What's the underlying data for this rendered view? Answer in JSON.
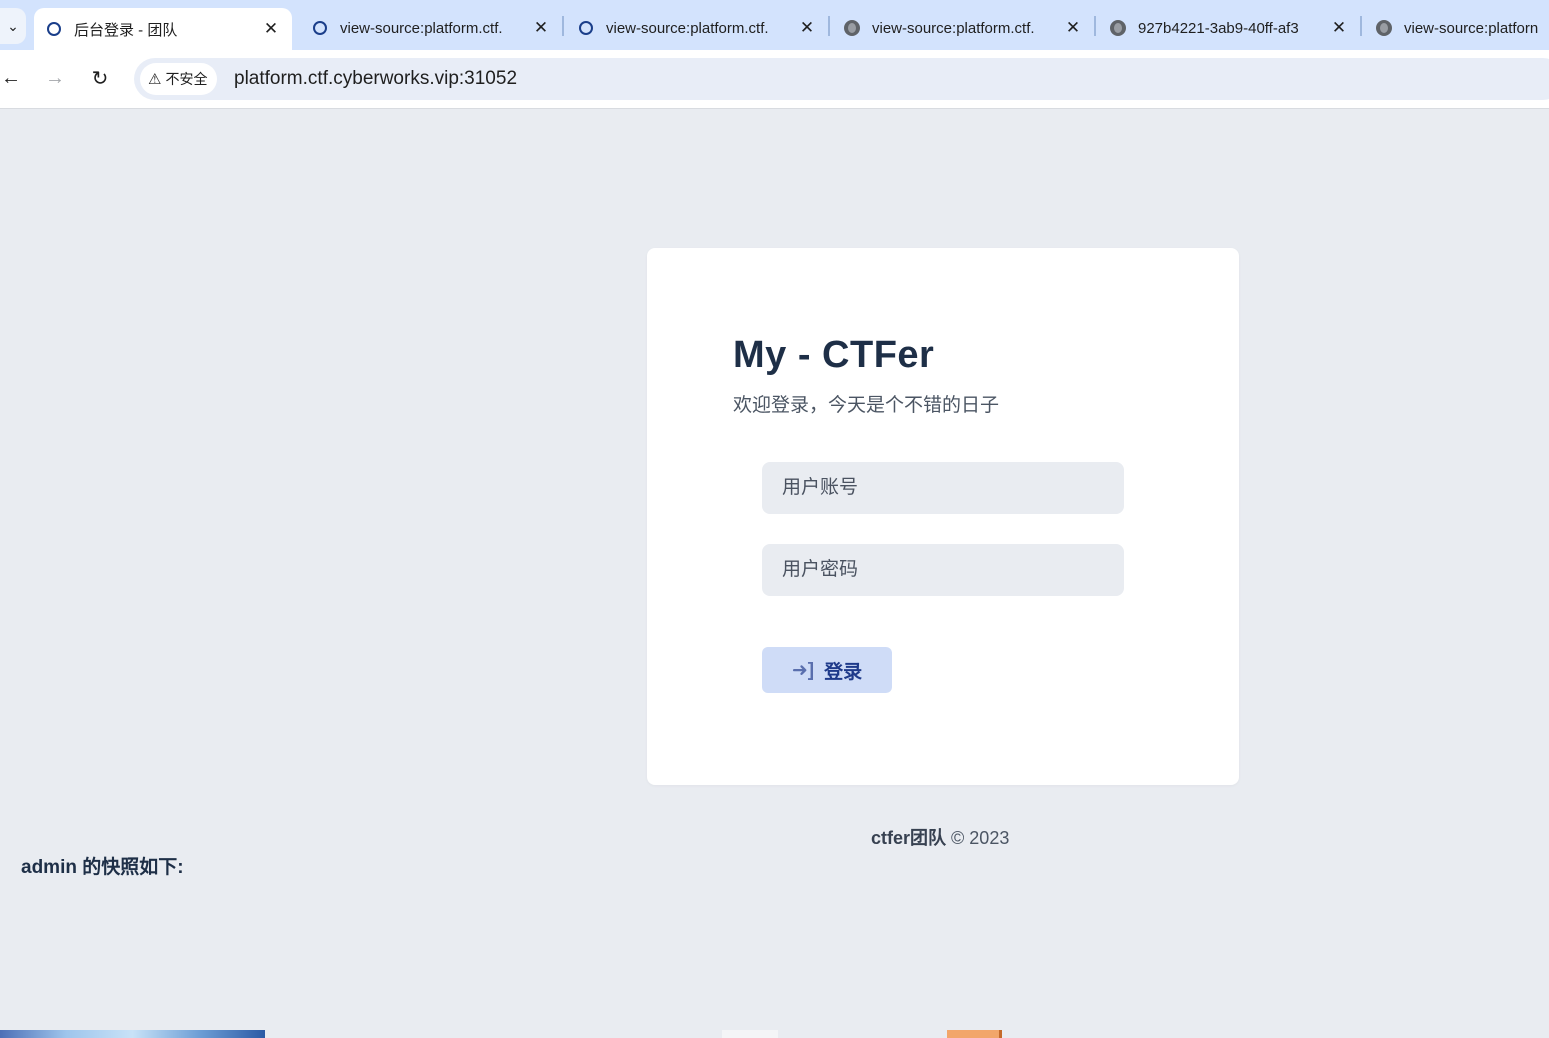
{
  "browser": {
    "tabs": [
      {
        "title": "后台登录 - 团队",
        "favicon": "loading-ring-icon",
        "active": true
      },
      {
        "title": "view-source:platform.ctf.",
        "favicon": "loading-ring-icon",
        "active": false
      },
      {
        "title": "view-source:platform.ctf.",
        "favicon": "loading-ring-icon",
        "active": false
      },
      {
        "title": "view-source:platform.ctf.",
        "favicon": "globe-icon",
        "active": false
      },
      {
        "title": "927b4221-3ab9-40ff-af3",
        "favicon": "globe-icon",
        "active": false
      },
      {
        "title": "view-source:platforn",
        "favicon": "globe-icon",
        "active": false
      }
    ],
    "security_label": "不安全",
    "url": "platform.ctf.cyberworks.vip:31052"
  },
  "login": {
    "title": "My - CTFer",
    "subtitle": "欢迎登录，今天是个不错的日子",
    "username_placeholder": "用户账号",
    "password_placeholder": "用户密码",
    "submit_label": "登录"
  },
  "footer": {
    "team": "ctfer团队",
    "copyright": "© 2023"
  },
  "snapshot_caption": "admin 的快照如下:",
  "colors": {
    "page_bg": "#e9ecf1",
    "card_bg": "#ffffff",
    "button_bg": "#cfdcf7",
    "button_text": "#1e3a8a",
    "title_text": "#1e2f47"
  }
}
